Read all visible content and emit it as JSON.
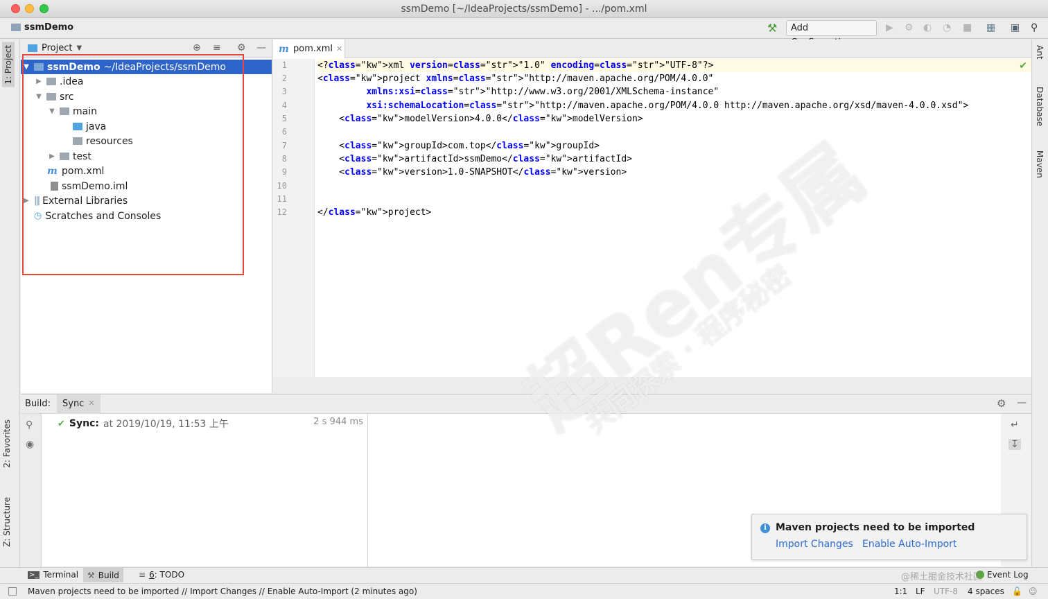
{
  "window": {
    "title": "ssmDemo [~/IdeaProjects/ssmDemo] - .../pom.xml"
  },
  "navbar": {
    "project_name": "ssmDemo",
    "add_configuration": "Add Configuration..."
  },
  "left_strip": {
    "project_tab": "1: Project",
    "favorites_tab": "2: Favorites",
    "structure_tab": "Z: Structure"
  },
  "right_strip": {
    "ant_tab": "Ant",
    "database_tab": "Database",
    "maven_tab": "Maven"
  },
  "project_panel": {
    "view_label": "Project",
    "tree": [
      {
        "label": "ssmDemo",
        "suffix": "~/IdeaProjects/ssmDemo"
      },
      {
        "label": ".idea"
      },
      {
        "label": "src"
      },
      {
        "label": "main"
      },
      {
        "label": "java"
      },
      {
        "label": "resources"
      },
      {
        "label": "test"
      },
      {
        "label": "pom.xml"
      },
      {
        "label": "ssmDemo.iml"
      },
      {
        "label": "External Libraries"
      },
      {
        "label": "Scratches and Consoles"
      }
    ]
  },
  "editor": {
    "tab_label": "pom.xml",
    "line_numbers": [
      "1",
      "2",
      "3",
      "4",
      "5",
      "6",
      "7",
      "8",
      "9",
      "10",
      "11",
      "12"
    ],
    "lines": [
      "<?xml version=\"1.0\" encoding=\"UTF-8\"?>",
      "<project xmlns=\"http://maven.apache.org/POM/4.0.0\"",
      "         xmlns:xsi=\"http://www.w3.org/2001/XMLSchema-instance\"",
      "         xsi:schemaLocation=\"http://maven.apache.org/POM/4.0.0 http://maven.apache.org/xsd/maven-4.0.0.xsd\">",
      "    <modelVersion>4.0.0</modelVersion>",
      "",
      "    <groupId>com.top</groupId>",
      "    <artifactId>ssmDemo</artifactId>",
      "    <version>1.0-SNAPSHOT</version>",
      "",
      "",
      "</project>"
    ]
  },
  "build_panel": {
    "label": "Build:",
    "tab": "Sync",
    "sync_title": "Sync:",
    "sync_detail": "at 2019/10/19, 11:53 上午",
    "sync_duration": "2 s 944 ms"
  },
  "notification": {
    "title": "Maven projects need to be imported",
    "import_changes": "Import Changes",
    "enable_auto_import": "Enable Auto-Import"
  },
  "bottom_bar": {
    "terminal": "Terminal",
    "build": "Build",
    "todo_num": "6",
    "todo": ": TODO",
    "event_log": "Event Log"
  },
  "status_bar": {
    "message": "Maven projects need to be imported // Import Changes // Enable Auto-Import (2 minutes ago)",
    "position": "1:1",
    "line_sep": "LF",
    "encoding": "UTF-8",
    "indent": "4 spaces"
  },
  "watermark": {
    "main": "超Ren专属",
    "sub": "共同探索 · 程序秘密",
    "corner": "@稀土掘金技术社区"
  },
  "colors": {
    "selection": "#2f65ca",
    "highlight_box": "#e8453c",
    "link": "#2a6ad0",
    "success": "#59a83b"
  }
}
